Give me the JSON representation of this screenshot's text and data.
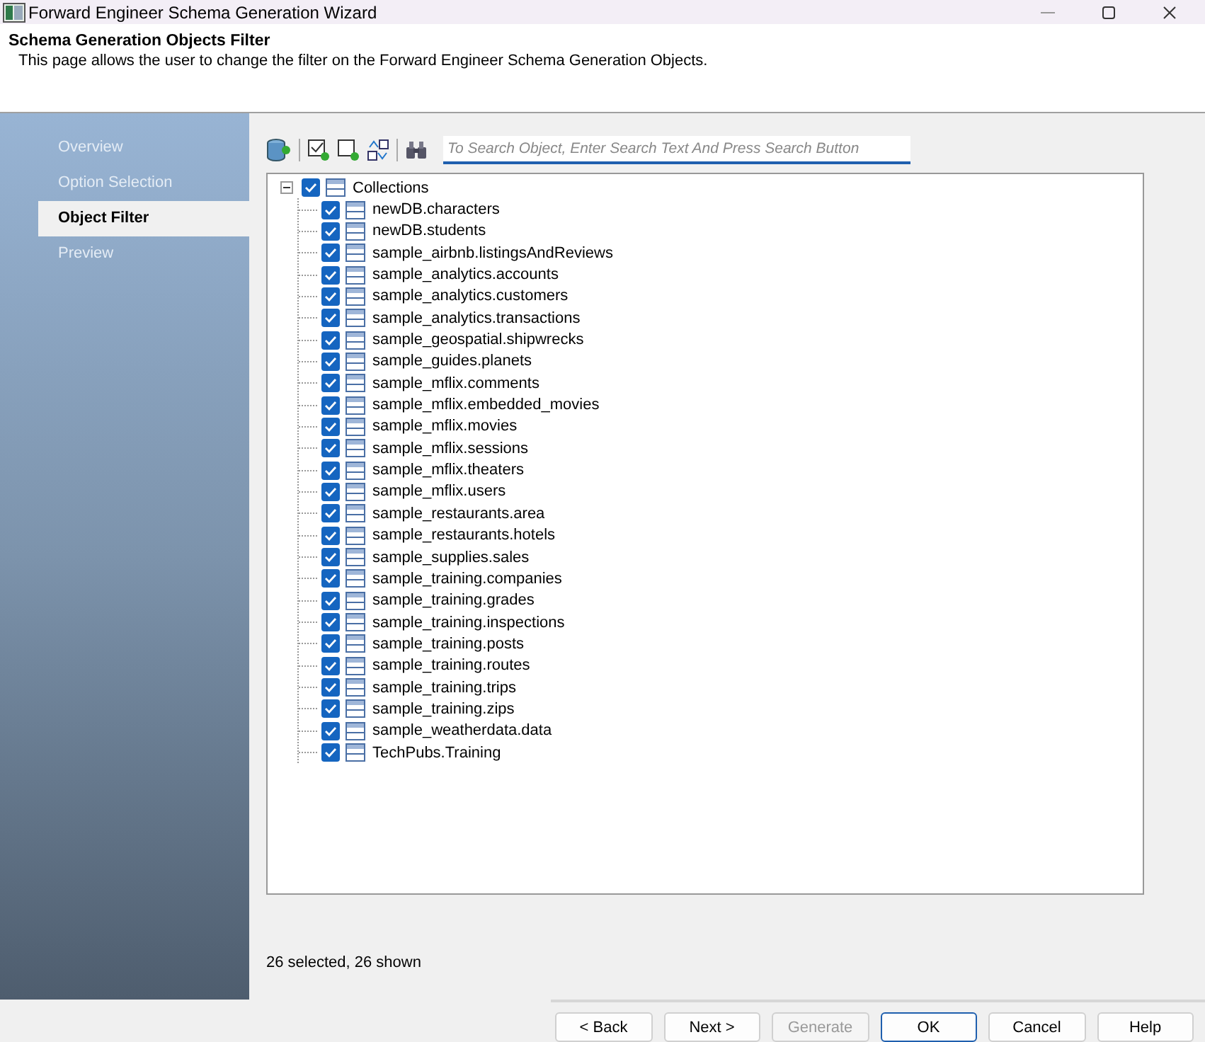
{
  "window": {
    "title": "Forward Engineer Schema Generation Wizard"
  },
  "header": {
    "title": "Schema Generation Objects Filter",
    "description": "This page allows the user to change the filter on the Forward Engineer Schema Generation Objects."
  },
  "sidebar": {
    "items": [
      {
        "label": "Overview",
        "selected": false
      },
      {
        "label": "Option Selection",
        "selected": false
      },
      {
        "label": "Object Filter",
        "selected": true
      },
      {
        "label": "Preview",
        "selected": false
      }
    ]
  },
  "search": {
    "placeholder": "To Search Object, Enter Search Text And Press Search Button"
  },
  "tree": {
    "label": "Collections",
    "checked": true,
    "expanded": true,
    "children": [
      {
        "label": "newDB.characters",
        "checked": true
      },
      {
        "label": "newDB.students",
        "checked": true
      },
      {
        "label": "sample_airbnb.listingsAndReviews",
        "checked": true
      },
      {
        "label": "sample_analytics.accounts",
        "checked": true
      },
      {
        "label": "sample_analytics.customers",
        "checked": true
      },
      {
        "label": "sample_analytics.transactions",
        "checked": true
      },
      {
        "label": "sample_geospatial.shipwrecks",
        "checked": true
      },
      {
        "label": "sample_guides.planets",
        "checked": true
      },
      {
        "label": "sample_mflix.comments",
        "checked": true
      },
      {
        "label": "sample_mflix.embedded_movies",
        "checked": true
      },
      {
        "label": "sample_mflix.movies",
        "checked": true
      },
      {
        "label": "sample_mflix.sessions",
        "checked": true
      },
      {
        "label": "sample_mflix.theaters",
        "checked": true
      },
      {
        "label": "sample_mflix.users",
        "checked": true
      },
      {
        "label": "sample_restaurants.area",
        "checked": true
      },
      {
        "label": "sample_restaurants.hotels",
        "checked": true
      },
      {
        "label": "sample_supplies.sales",
        "checked": true
      },
      {
        "label": "sample_training.companies",
        "checked": true
      },
      {
        "label": "sample_training.grades",
        "checked": true
      },
      {
        "label": "sample_training.inspections",
        "checked": true
      },
      {
        "label": "sample_training.posts",
        "checked": true
      },
      {
        "label": "sample_training.routes",
        "checked": true
      },
      {
        "label": "sample_training.trips",
        "checked": true
      },
      {
        "label": "sample_training.zips",
        "checked": true
      },
      {
        "label": "sample_weatherdata.data",
        "checked": true
      },
      {
        "label": "TechPubs.Training",
        "checked": true
      }
    ]
  },
  "status": "26 selected, 26 shown",
  "buttons": [
    {
      "label": "< Back",
      "disabled": false,
      "default": false
    },
    {
      "label": "Next >",
      "disabled": false,
      "default": false
    },
    {
      "label": "Generate",
      "disabled": true,
      "default": false
    },
    {
      "label": "OK",
      "disabled": false,
      "default": true
    },
    {
      "label": "Cancel",
      "disabled": false,
      "default": false
    },
    {
      "label": "Help",
      "disabled": false,
      "default": false
    }
  ]
}
